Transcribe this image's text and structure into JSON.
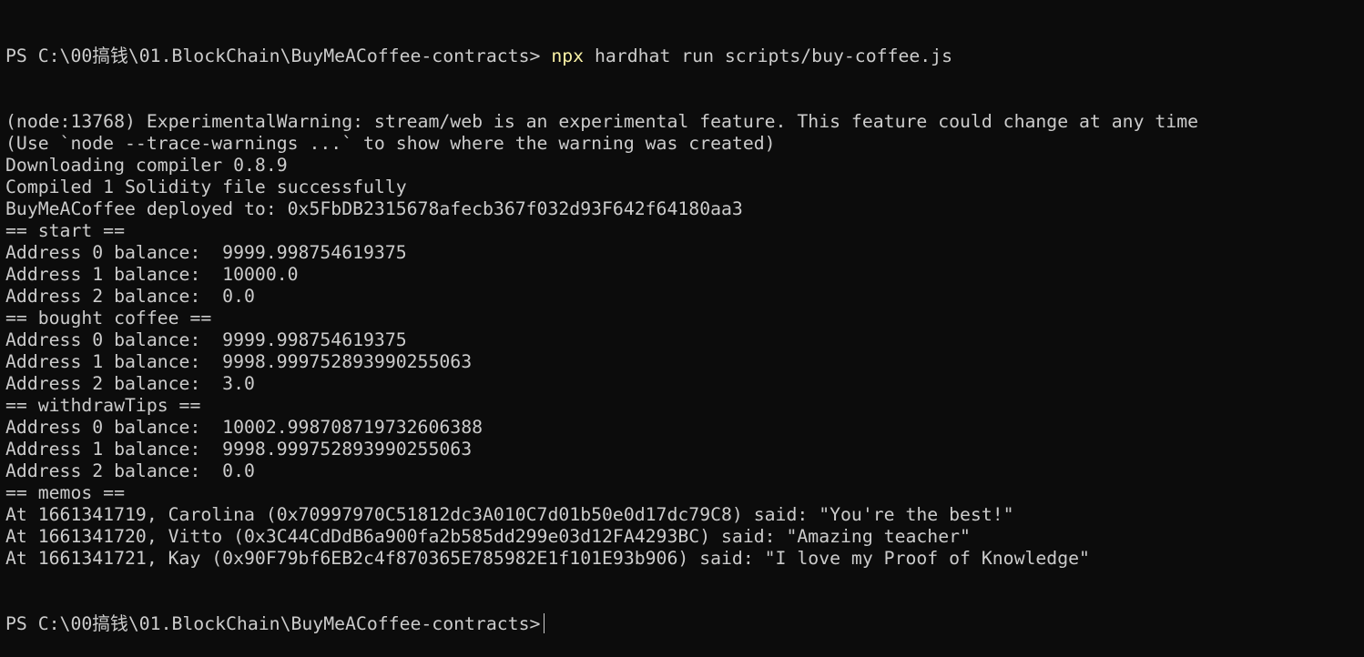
{
  "terminal": {
    "prompt_path": "PS C:\\00搞钱\\01.BlockChain\\BuyMeACoffee-contracts>",
    "command": {
      "program": "npx",
      "args": "hardhat run scripts/buy-coffee.js"
    },
    "output_lines": [
      "(node:13768) ExperimentalWarning: stream/web is an experimental feature. This feature could change at any time",
      "(Use `node --trace-warnings ...` to show where the warning was created)",
      "Downloading compiler 0.8.9",
      "Compiled 1 Solidity file successfully",
      "BuyMeACoffee deployed to: 0x5FbDB2315678afecb367f032d93F642f64180aa3",
      "== start ==",
      "Address 0 balance:  9999.998754619375",
      "Address 1 balance:  10000.0",
      "Address 2 balance:  0.0",
      "== bought coffee ==",
      "Address 0 balance:  9999.998754619375",
      "Address 1 balance:  9998.999752893990255063",
      "Address 2 balance:  3.0",
      "== withdrawTips ==",
      "Address 0 balance:  10002.998708719732606388",
      "Address 1 balance:  9998.999752893990255063",
      "Address 2 balance:  0.0",
      "== memos ==",
      "At 1661341719, Carolina (0x70997970C51812dc3A010C7d01b50e0d17dc79C8) said: \"You're the best!\"",
      "At 1661341720, Vitto (0x3C44CdDdB6a900fa2b585dd299e03d12FA4293BC) said: \"Amazing teacher\"",
      "At 1661341721, Kay (0x90F79bf6EB2c4f870365E785982E1f101E93b906) said: \"I love my Proof of Knowledge\""
    ],
    "final_prompt": "PS C:\\00搞钱\\01.BlockChain\\BuyMeACoffee-contracts>",
    "colors": {
      "background": "#0c0c0c",
      "foreground": "#cccccc",
      "command_highlight": "#f9f1a5"
    }
  }
}
